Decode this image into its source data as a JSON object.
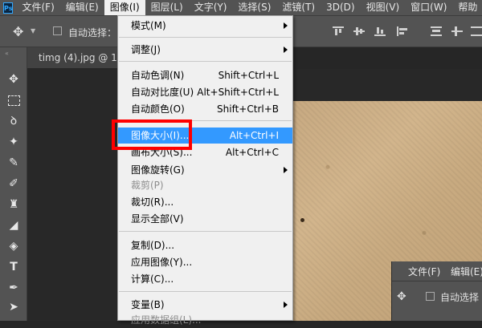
{
  "app": {
    "logo": "Ps"
  },
  "menubar": {
    "items": [
      "文件(F)",
      "编辑(E)",
      "图像(I)",
      "图层(L)",
      "文字(Y)",
      "选择(S)",
      "滤镜(T)",
      "3D(D)",
      "视图(V)",
      "窗口(W)",
      "帮助"
    ],
    "active_index": 2
  },
  "options_bar": {
    "auto_select_label": "自动选择："
  },
  "document_tab": {
    "title": "timg (4).jpg @ 1"
  },
  "image_menu": {
    "items": [
      {
        "label": "模式(M)",
        "shortcut": "",
        "submenu": true,
        "state": "normal"
      },
      {
        "label": "调整(J)",
        "shortcut": "",
        "submenu": true,
        "state": "normal"
      },
      {
        "label": "自动色调(N)",
        "shortcut": "Shift+Ctrl+L",
        "submenu": false,
        "state": "normal"
      },
      {
        "label": "自动对比度(U)",
        "shortcut": "Alt+Shift+Ctrl+L",
        "submenu": false,
        "state": "normal"
      },
      {
        "label": "自动颜色(O)",
        "shortcut": "Shift+Ctrl+B",
        "submenu": false,
        "state": "normal"
      },
      {
        "label": "图像大小(I)...",
        "shortcut": "Alt+Ctrl+I",
        "submenu": false,
        "state": "highlighted"
      },
      {
        "label": "画布大小(S)...",
        "shortcut": "Alt+Ctrl+C",
        "submenu": false,
        "state": "normal"
      },
      {
        "label": "图像旋转(G)",
        "shortcut": "",
        "submenu": true,
        "state": "normal"
      },
      {
        "label": "裁剪(P)",
        "shortcut": "",
        "submenu": false,
        "state": "disabled"
      },
      {
        "label": "裁切(R)...",
        "shortcut": "",
        "submenu": false,
        "state": "normal"
      },
      {
        "label": "显示全部(V)",
        "shortcut": "",
        "submenu": false,
        "state": "normal"
      },
      {
        "label": "复制(D)...",
        "shortcut": "",
        "submenu": false,
        "state": "normal"
      },
      {
        "label": "应用图像(Y)...",
        "shortcut": "",
        "submenu": false,
        "state": "normal"
      },
      {
        "label": "计算(C)...",
        "shortcut": "",
        "submenu": false,
        "state": "normal"
      },
      {
        "label": "变量(B)",
        "shortcut": "",
        "submenu": true,
        "state": "normal"
      },
      {
        "label": "应用数据组(L)...",
        "shortcut": "",
        "submenu": false,
        "state": "disabled"
      }
    ]
  },
  "second_window": {
    "menu": [
      "文件(F)",
      "编辑(E)"
    ],
    "auto_select_label": "自动选择"
  },
  "colors": {
    "highlight": "#3399ff",
    "annotation_box": "#ff0000",
    "panel": "#535353"
  }
}
